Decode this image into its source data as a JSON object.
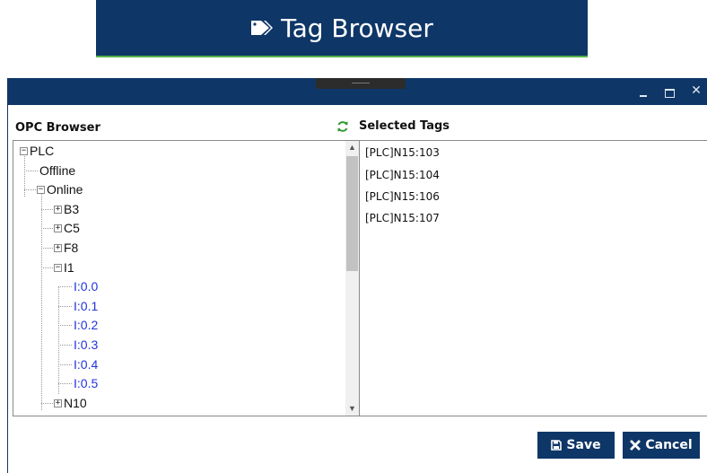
{
  "banner": {
    "title": "Tag Browser",
    "icon": "tag-icon"
  },
  "window": {
    "controls": [
      "minimize-icon",
      "maximize-icon",
      "close-icon"
    ],
    "close_glyph": "✕"
  },
  "opc_browser": {
    "header": "OPC Browser",
    "refresh_icon": "refresh-icon",
    "tree": [
      {
        "label": "PLC",
        "level": 0,
        "expander": "⊟",
        "color": "default"
      },
      {
        "label": "Offline",
        "level": 1,
        "expander": "",
        "color": "default"
      },
      {
        "label": "Online",
        "level": 1,
        "expander": "⊟",
        "color": "default"
      },
      {
        "label": "B3",
        "level": 2,
        "expander": "⊞",
        "color": "default"
      },
      {
        "label": "C5",
        "level": 2,
        "expander": "⊞",
        "color": "default"
      },
      {
        "label": "F8",
        "level": 2,
        "expander": "⊞",
        "color": "default"
      },
      {
        "label": "I1",
        "level": 2,
        "expander": "⊟",
        "color": "default"
      },
      {
        "label": "I:0.0",
        "level": 3,
        "expander": "",
        "color": "blue"
      },
      {
        "label": "I:0.1",
        "level": 3,
        "expander": "",
        "color": "blue"
      },
      {
        "label": "I:0.2",
        "level": 3,
        "expander": "",
        "color": "blue"
      },
      {
        "label": "I:0.3",
        "level": 3,
        "expander": "",
        "color": "blue"
      },
      {
        "label": "I:0.4",
        "level": 3,
        "expander": "",
        "color": "blue"
      },
      {
        "label": "I:0.5",
        "level": 3,
        "expander": "",
        "color": "blue"
      },
      {
        "label": "N10",
        "level": 2,
        "expander": "⊞",
        "color": "default"
      }
    ]
  },
  "selected_tags": {
    "header": "Selected Tags",
    "items": [
      "[PLC]N15:103",
      "[PLC]N15:104",
      "[PLC]N15:106",
      "[PLC]N15:107"
    ]
  },
  "buttons": {
    "save": "Save",
    "cancel": "Cancel"
  },
  "colors": {
    "brand_navy": "#0e3667",
    "accent_green": "#55b24a",
    "tag_blue": "#2233dd"
  }
}
